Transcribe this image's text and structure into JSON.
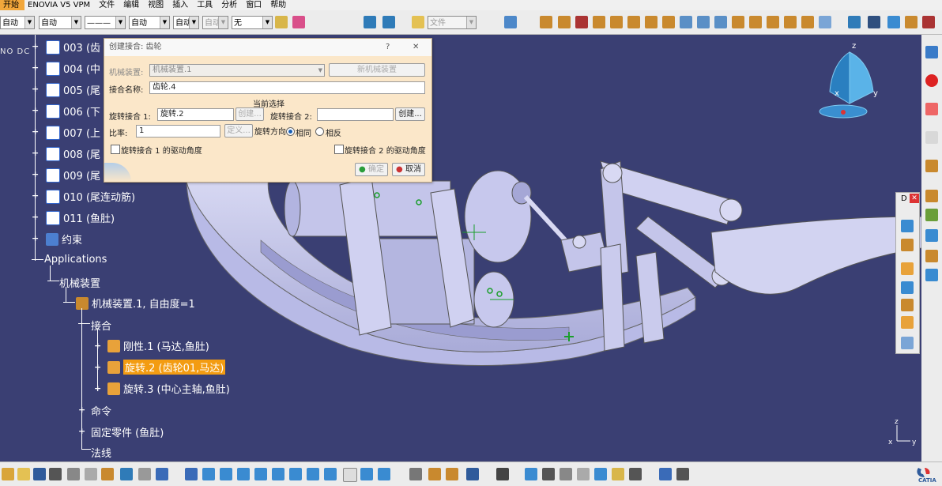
{
  "menu": {
    "items": [
      "开始",
      "ENOVIA V5 VPM",
      "文件",
      "编辑",
      "视图",
      "插入",
      "工具",
      "分析",
      "窗口",
      "帮助"
    ]
  },
  "toolbar": {
    "combo1": "自动",
    "combo2": "自动",
    "combo3": "———",
    "combo4": "自动",
    "combo5": "自动",
    "combo6": "自动",
    "combo7": "无",
    "file_combo": "文件"
  },
  "tree": {
    "header_fragment": "NO DC",
    "items": [
      {
        "label": "003 (齿"
      },
      {
        "label": "004 (中"
      },
      {
        "label": "005 (尾"
      },
      {
        "label": "006 (下"
      },
      {
        "label": "007 (上"
      },
      {
        "label": "008 (尾"
      },
      {
        "label": "009 (尾"
      },
      {
        "label": "010 (尾连动筋)"
      },
      {
        "label": "011 (鱼肚)"
      }
    ],
    "constraints": "约束",
    "applications": "Applications",
    "mechanisms": "机械装置",
    "mechanism1": "机械装置.1, 自由度=1",
    "joints": "接合",
    "joint_rigid": "刚性.1 (马达,鱼肚)",
    "joint_rev2": "旋转.2 (齿轮01,马达)",
    "joint_rev3": "旋转.3 (中心主轴,鱼肚)",
    "commands": "命令",
    "fixed_part": "固定零件 (鱼肚)",
    "laws": "法线"
  },
  "dialog": {
    "title": "创建接合: 齿轮",
    "help": "?",
    "close": "✕",
    "mechanism_label": "机械装置:",
    "mechanism_value": "机械装置.1",
    "new_mechanism_btn": "新机械装置",
    "joint_name_label": "接合名称:",
    "joint_name_value": "齿轮.4",
    "current_selection": "当前选择",
    "rev1_label": "旋转接合 1:",
    "rev1_value": "旋转.2",
    "rev1_create": "创建...",
    "rev2_label": "旋转接合 2:",
    "rev2_value": "",
    "rev2_create": "创建...",
    "ratio_label": "比率:",
    "ratio_value": "1",
    "define_btn": "定义...",
    "direction_label": "旋转方向",
    "same": "相同",
    "opposite": "相反",
    "drive1": "旋转接合 1 的驱动角度",
    "drive2": "旋转接合 2 的驱动角度",
    "ok": "确定",
    "cancel": "取消"
  },
  "compass": {
    "x": "x",
    "y": "y",
    "z": "z"
  },
  "axis": {
    "x": "x",
    "y": "y",
    "z": "z"
  },
  "float_toolbar": {
    "title": "D"
  },
  "brand": "CATIA"
}
